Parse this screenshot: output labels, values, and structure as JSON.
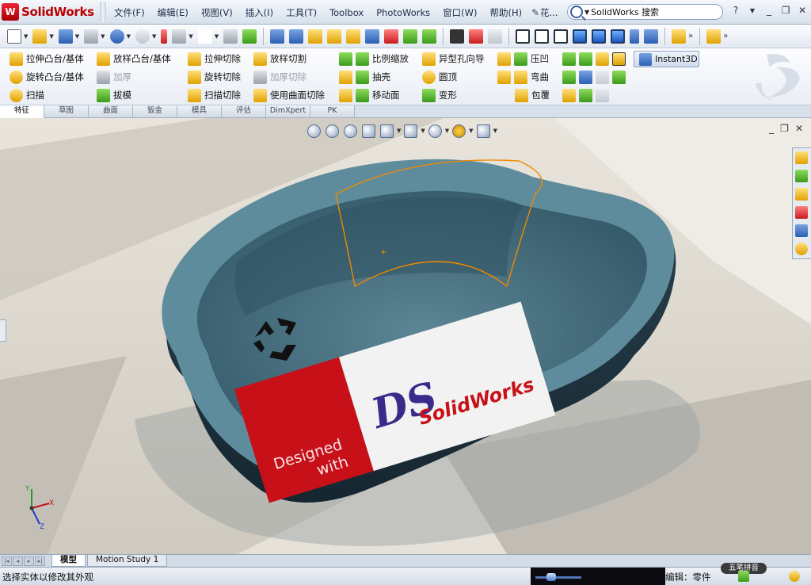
{
  "app": {
    "badge": "W",
    "name": "SolidWorks"
  },
  "menu": [
    "文件(F)",
    "编辑(E)",
    "视图(V)",
    "插入(I)",
    "工具(T)",
    "Toolbox",
    "PhotoWorks",
    "窗口(W)",
    "帮助(H)"
  ],
  "document": {
    "name": "花...",
    "arrows": "◂▸"
  },
  "search": {
    "value": "SolidWorks 搜索",
    "placeholder": "SolidWorks 搜索"
  },
  "window_controls": {
    "help": "?",
    "minimize": "_",
    "restore": "❐",
    "close": "✕"
  },
  "command_manager": {
    "col1": [
      "拉伸凸台/基体",
      "旋转凸台/基体",
      "扫描"
    ],
    "col2": [
      "放样凸台/基体",
      "加厚",
      "拔模"
    ],
    "col3": [
      "拉伸切除",
      "旋转切除",
      "扫描切除"
    ],
    "col4": [
      "放样切割",
      "加厚切除",
      "使用曲面切除"
    ],
    "col5": [
      "比例缩放",
      "抽壳",
      "移动面"
    ],
    "col6": [
      "异型孔向导",
      "圆顶",
      "变形"
    ],
    "col7": [
      "压凹",
      "弯曲",
      "包覆"
    ],
    "instant3d": "Instant3D"
  },
  "tabs": [
    "特征",
    "草图",
    "曲面",
    "钣金",
    "模具",
    "评估",
    "DimXpert",
    "PK"
  ],
  "model": {
    "label_designed": "Designed",
    "label_with": "with",
    "label_logo_ds": "DS",
    "label_logo_brand": "SolidWorks"
  },
  "triad": {
    "x": "X",
    "y": "Y",
    "z": "Z"
  },
  "bottom_tabs": [
    "模型",
    "Motion Study 1"
  ],
  "status": {
    "message": "选择实体以修改其外观",
    "mode": "编辑：零件",
    "ime": "五笔拼音"
  },
  "colors": {
    "tray": "#3f6b7c",
    "tray_rim": "#5e8c9c",
    "logo_red": "#c81018",
    "selection": "#f08a00"
  }
}
